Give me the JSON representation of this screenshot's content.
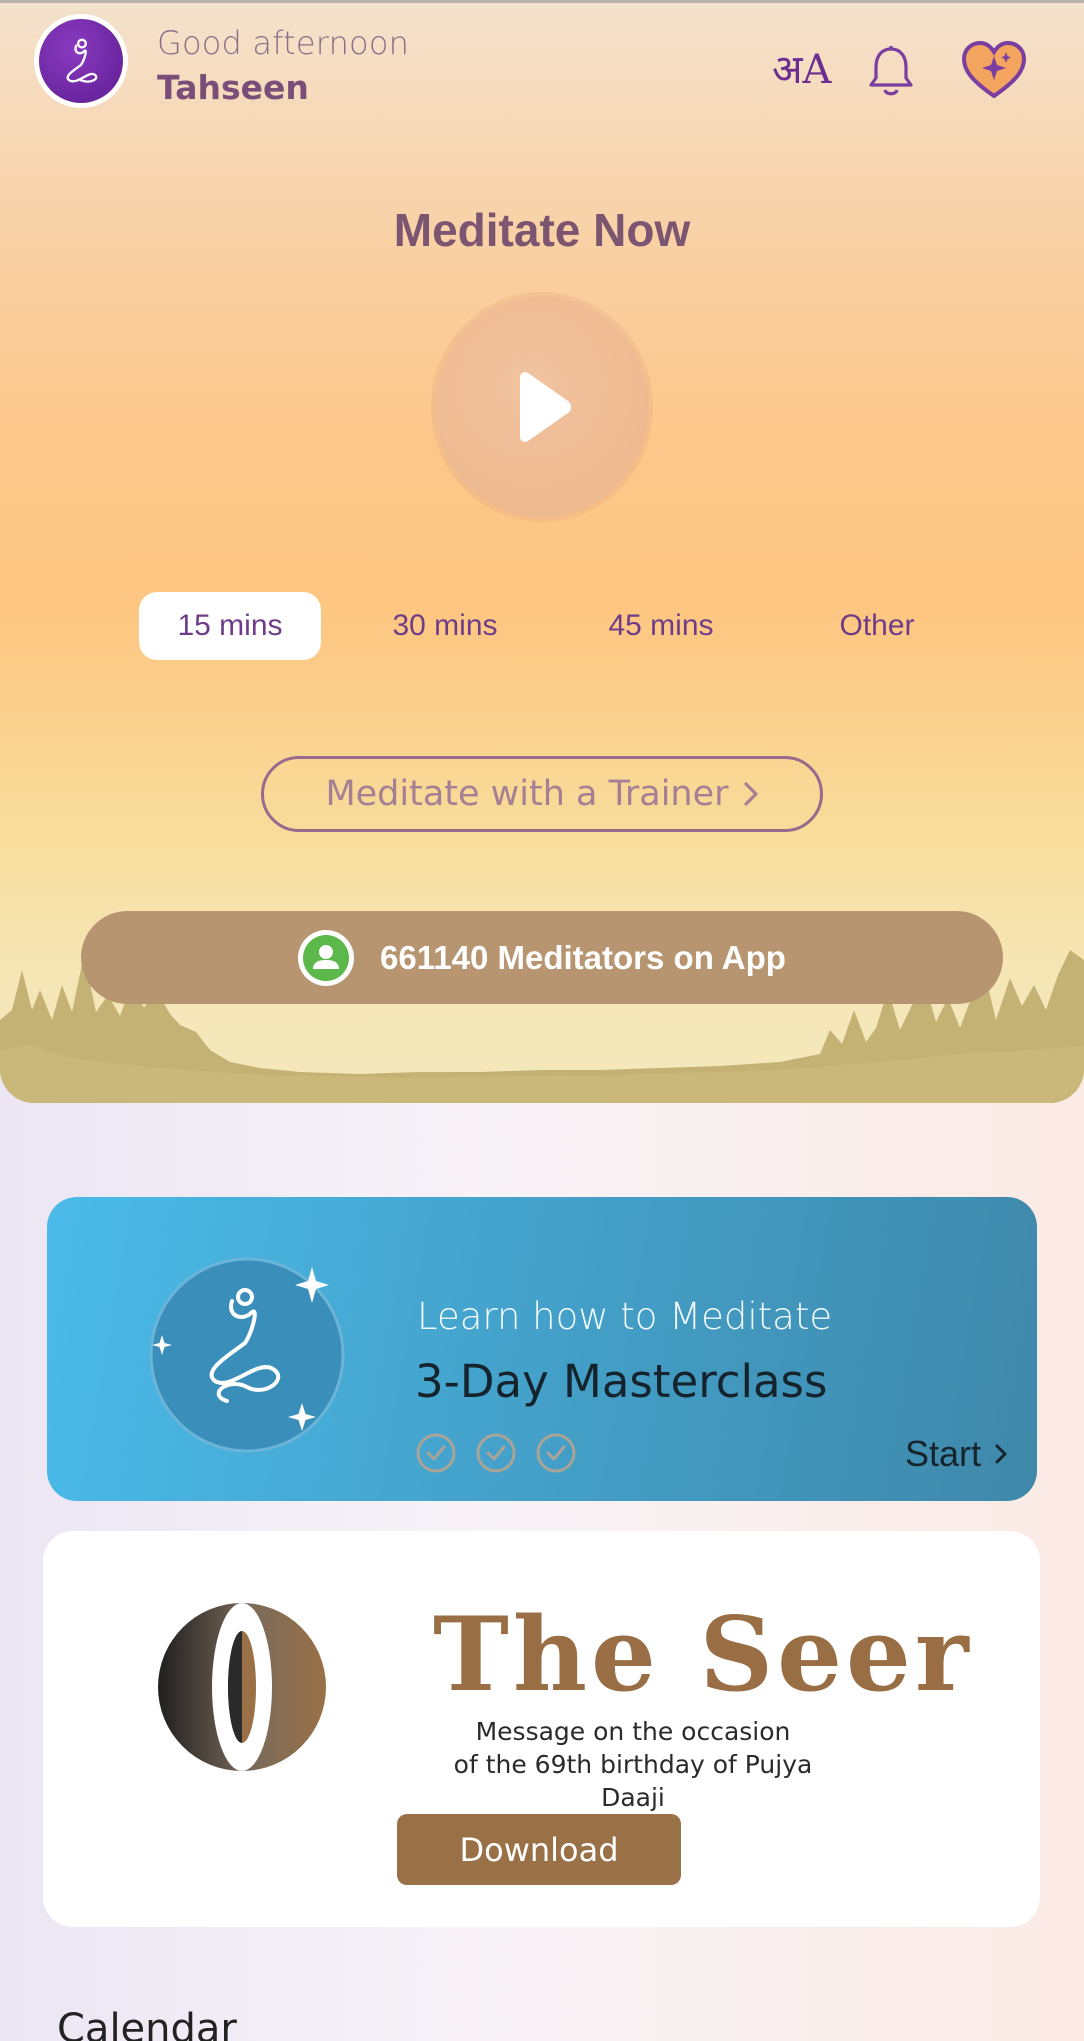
{
  "header": {
    "greeting": "Good afternoon",
    "user_name": "Tahseen",
    "icons": {
      "avatar": "heartfulness-logo-icon",
      "language": "language-switch-icon",
      "notifications": "bell-icon",
      "favorites": "heart-sparkle-icon"
    },
    "language_glyph": "अA"
  },
  "meditate": {
    "title": "Meditate Now",
    "play_icon": "play-icon",
    "durations": [
      "15 mins",
      "30 mins",
      "45 mins",
      "Other"
    ],
    "selected_duration": "15 mins",
    "trainer_button": "Meditate with a Trainer",
    "meditators_text": "661140 Meditators on App"
  },
  "masterclass": {
    "subtitle": "Learn how to Meditate",
    "title": "3-Day Masterclass",
    "start_label": "Start",
    "progress_completed": 0,
    "progress_total": 3
  },
  "seer": {
    "title": "The Seer",
    "message_line1": "Message on the occasion",
    "message_line2": "of the 69th birthday of Pujya Daaji",
    "download_label": "Download"
  },
  "calendar": {
    "title": "Calendar"
  },
  "colors": {
    "accent_purple": "#6f3d88",
    "meditators_bar": "#b89571",
    "masterclass_blue": "#44a3cc",
    "seer_brown": "#9a6e44",
    "online_green": "#5cb84a"
  }
}
